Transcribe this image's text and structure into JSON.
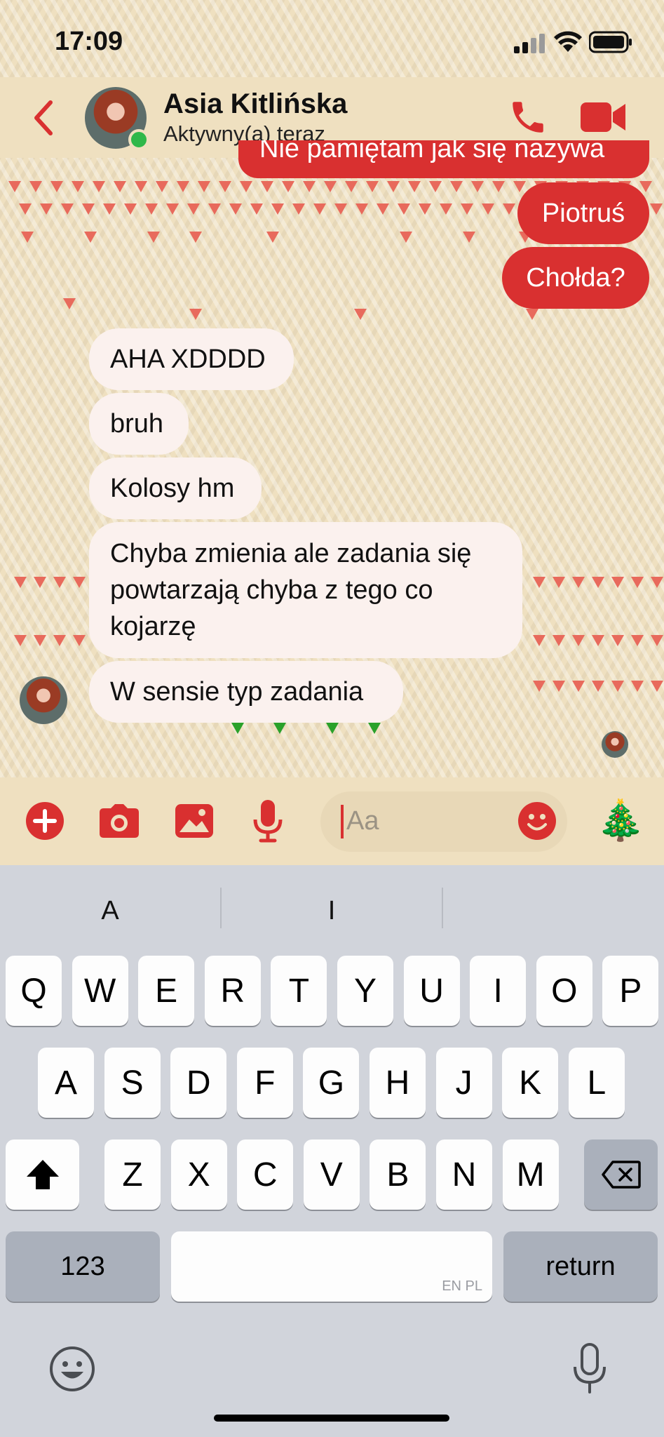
{
  "status_bar": {
    "time": "17:09"
  },
  "header": {
    "contact_name": "Asia Kitlińska",
    "contact_status": "Aktywny(a) teraz"
  },
  "messages": {
    "partial_out": "Nie pamiętam jak się nazywa",
    "out_1": "Piotruś",
    "out_2": "Chołda?",
    "in_1": "AHA XDDDD",
    "in_2": "bruh",
    "in_3": "Kolosy hm",
    "in_4_line1": "Chyba zmienia ale zadania się",
    "in_4_line2": "powtarzają chyba z tego co",
    "in_4_line3": "kojarzę",
    "in_5": "W sensie typ zadania"
  },
  "composer": {
    "placeholder": "Aa",
    "tree_emoji": "🎄"
  },
  "keyboard": {
    "suggestions": [
      "A",
      "I",
      ""
    ],
    "row1": [
      "Q",
      "W",
      "E",
      "R",
      "T",
      "Y",
      "U",
      "I",
      "O",
      "P"
    ],
    "row2": [
      "A",
      "S",
      "D",
      "F",
      "G",
      "H",
      "J",
      "K",
      "L"
    ],
    "row3": [
      "Z",
      "X",
      "C",
      "V",
      "B",
      "N",
      "M"
    ],
    "numbers_label": "123",
    "space_lang": "EN PL",
    "return_label": "return"
  },
  "colors": {
    "accent": "#d93030",
    "background": "#efe0c0",
    "online": "#2fb84a"
  },
  "icons": [
    "back-chevron-icon",
    "phone-icon",
    "video-camera-icon",
    "plus-icon",
    "camera-icon",
    "image-icon",
    "microphone-icon",
    "smiley-icon",
    "shift-icon",
    "backspace-icon",
    "emoji-key-icon",
    "dictation-icon"
  ]
}
